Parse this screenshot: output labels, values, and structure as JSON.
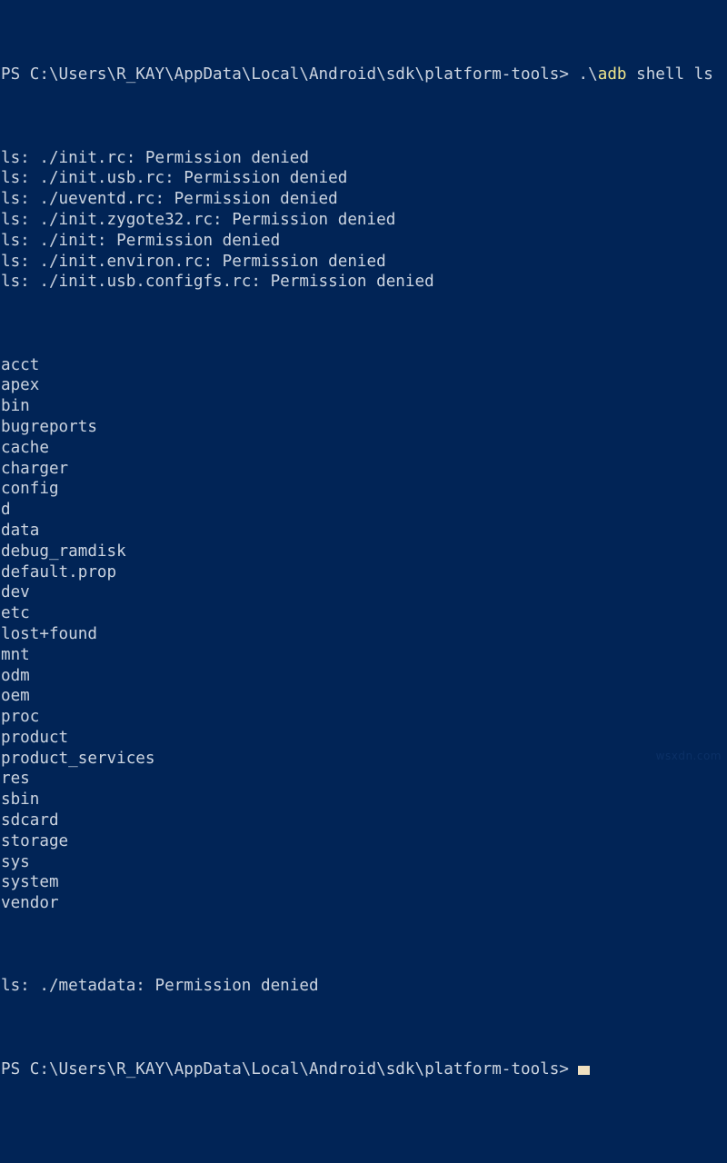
{
  "terminal": {
    "shell": "PowerShell",
    "background_color": "#012456",
    "foreground_color": "#ccd4e0",
    "accent_color": "#f0e68c",
    "cursor_color": "#f0e0c0",
    "prompt": "PS C:\\Users\\R_KAY\\AppData\\Local\\Android\\sdk\\platform-tools>",
    "command_line": {
      "prefix": " .\\",
      "executable": "adb",
      "arguments": " shell ls"
    },
    "errors_top": [
      "ls: ./init.rc: Permission denied",
      "ls: ./init.usb.rc: Permission denied",
      "ls: ./ueventd.rc: Permission denied",
      "ls: ./init.zygote32.rc: Permission denied",
      "ls: ./init: Permission denied",
      "ls: ./init.environ.rc: Permission denied",
      "ls: ./init.usb.configfs.rc: Permission denied"
    ],
    "listing": [
      "acct",
      "apex",
      "bin",
      "bugreports",
      "cache",
      "charger",
      "config",
      "d",
      "data",
      "debug_ramdisk",
      "default.prop",
      "dev",
      "etc",
      "lost+found",
      "mnt",
      "odm",
      "oem",
      "proc",
      "product",
      "product_services",
      "res",
      "sbin",
      "sdcard",
      "storage",
      "sys",
      "system",
      "vendor"
    ],
    "errors_bottom": [
      "ls: ./metadata: Permission denied"
    ],
    "final_prompt": "PS C:\\Users\\R_KAY\\AppData\\Local\\Android\\sdk\\platform-tools>"
  },
  "watermark": {
    "text": "wsxdn.com"
  }
}
